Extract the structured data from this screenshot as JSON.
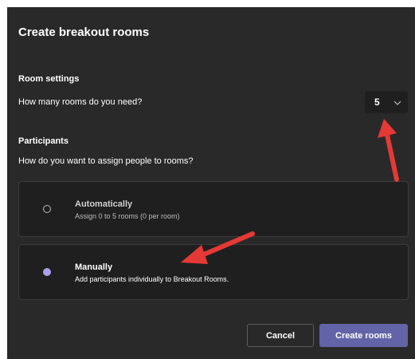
{
  "dialog": {
    "title": "Create breakout rooms"
  },
  "room_settings": {
    "heading": "Room settings",
    "question": "How many rooms do you need?",
    "rooms_count": "5"
  },
  "participants": {
    "heading": "Participants",
    "question": "How do you want to assign people to rooms?",
    "options": [
      {
        "title": "Automatically",
        "subtitle": "Assign 0 to 5 rooms (0 per room)",
        "selected": false
      },
      {
        "title": "Manually",
        "subtitle": "Add participants individually to Breakout Rooms.",
        "selected": true
      }
    ]
  },
  "buttons": {
    "cancel": "Cancel",
    "create": "Create rooms"
  },
  "colors": {
    "dialog_bg": "#292929",
    "card_bg": "#1f1f1f",
    "primary": "#6264a7",
    "radio_selected": "#a7a2e8",
    "annotation_arrow": "#e53935"
  },
  "icons": {
    "dropdown": "chevron-down-icon",
    "annotation": "red-arrow-icon"
  }
}
